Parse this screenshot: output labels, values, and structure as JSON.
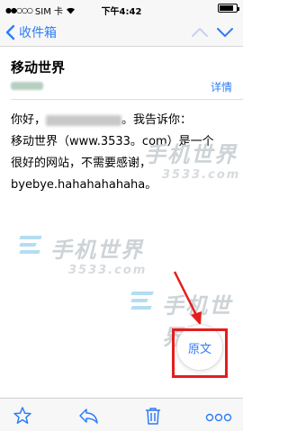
{
  "status_bar": {
    "carrier": "SIM 卡",
    "time": "下午4:42",
    "battery_level": 0.85
  },
  "nav": {
    "back_label": "收件箱",
    "icons": [
      "chevron-left-icon",
      "chevron-up-icon",
      "chevron-down-icon"
    ]
  },
  "email": {
    "subject": "移动世界",
    "details_label": "详情",
    "body_lines": [
      [
        "你好，",
        "。我告诉你："
      ],
      "移动世界（www.3533。com）是一个",
      "很好的网站，不需要感谢，",
      "byebye.hahahahahaha。"
    ]
  },
  "watermark": {
    "brand_text": "手机世界",
    "number_text": "3533.com"
  },
  "original_button": {
    "label": "原文"
  },
  "toolbar": {
    "icons": [
      "flag-icon",
      "reply-icon",
      "trash-icon",
      "more-icon"
    ]
  },
  "colors": {
    "accent": "#2f7cf6",
    "highlight_box": "#e51d1d",
    "bar_background": "#f7f7f8"
  }
}
